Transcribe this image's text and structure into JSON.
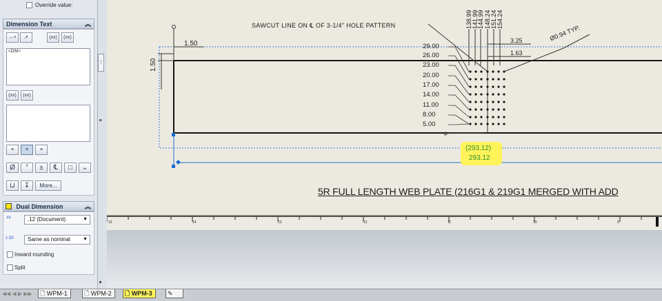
{
  "panel": {
    "override_label": "Override value:",
    "dimension_text_title": "Dimension Text",
    "text_area_content": "<DIM>",
    "more_label": "More...",
    "dual_dimension_title": "Dual Dimension",
    "precision_value": ".12 (Document)",
    "tolerance_value": "Same as nominal",
    "inward_rounding_label": "Inward rounding",
    "split_label": "Split",
    "tool_labels": {
      "add_paren": "(xx)",
      "inspect": "(xx)",
      "diameter": "Ø",
      "degree": "°",
      "plus_minus": "±",
      "centerline": "℄"
    }
  },
  "drawing": {
    "sawcut_note": "SAWCUT LINE ON ℄ OF 3-1/4\" HOLE PATTERN",
    "horiz_dim_left": "1.50",
    "vert_dim_left": "1.50",
    "top_dims": [
      "138.99",
      "141.99",
      "144.99",
      "148.24",
      "151.24",
      "154.24"
    ],
    "right_dims": [
      "3.25",
      "1.63"
    ],
    "hole_note": "Ø0.94 TYP.",
    "row_dims": [
      "29.00",
      "26.00",
      "23.00",
      "20.00",
      "17.00",
      "14.00",
      "11.00",
      "8.00",
      "5.00"
    ],
    "zero_mark": "0",
    "bottom_dim_1": "(293.12)",
    "bottom_dim_2": "293.12",
    "title_text": "5R FULL LENGTH WEB PLATE (216G1 & 219G1 MERGED WITH ADD"
  },
  "ruler": {
    "labels": [
      "15",
      "14",
      "13",
      "12",
      "11",
      "10",
      "9"
    ]
  },
  "tabs": [
    "WPM-1",
    "WPM-2",
    "WPM-3"
  ],
  "colors": {
    "highlight": "#fff35a",
    "dim_blue": "#1f6fd1",
    "dim_green": "#2f8f2f",
    "panel_bg": "#e3e6ec"
  }
}
